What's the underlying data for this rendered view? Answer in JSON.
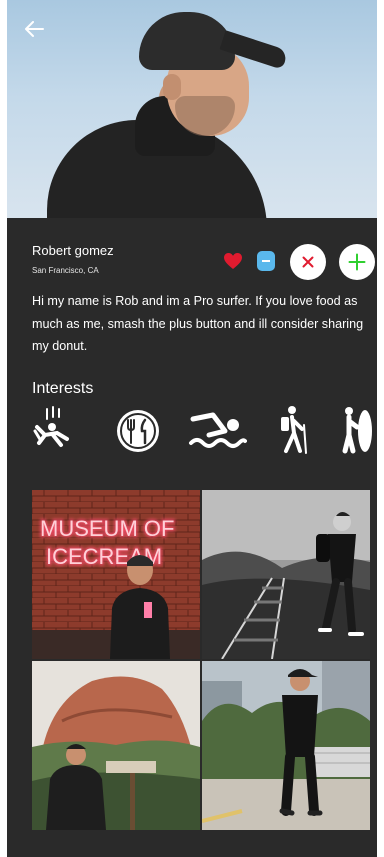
{
  "header": {
    "back_icon": "arrow-left-icon"
  },
  "profile": {
    "name": "Robert gomez",
    "location": "San Francisco, CA",
    "bio": "Hi my name is Rob and im a Pro surfer. If you love food as much as me, smash the plus button and ill consider sharing my donut."
  },
  "actions": [
    {
      "icon": "heart-icon",
      "color": "#e01b2f"
    },
    {
      "icon": "minus-icon",
      "color": "#5ab8ec"
    },
    {
      "icon": "close-icon",
      "color": "#e01b2f"
    },
    {
      "icon": "plus-icon",
      "color": "#2fcf2f"
    }
  ],
  "interests": {
    "title": "Interests",
    "items": [
      {
        "icon": "skydiving-icon"
      },
      {
        "icon": "dining-icon"
      },
      {
        "icon": "swimming-icon"
      },
      {
        "icon": "hiking-icon"
      },
      {
        "icon": "surfing-icon"
      }
    ]
  },
  "gallery": {
    "neon_sign": [
      "MUSEUM OF",
      "ICECREAM"
    ],
    "photos": [
      {
        "subject": "man-in-front-of-neon-sign-photo"
      },
      {
        "subject": "man-on-railroad-tracks-photo"
      },
      {
        "subject": "man-in-desert-photo"
      },
      {
        "subject": "man-on-street-photo"
      }
    ]
  },
  "colors": {
    "background": "#2a2a2a",
    "heart": "#e01b2f",
    "minus": "#5ab8ec",
    "plus": "#2fcf2f"
  }
}
